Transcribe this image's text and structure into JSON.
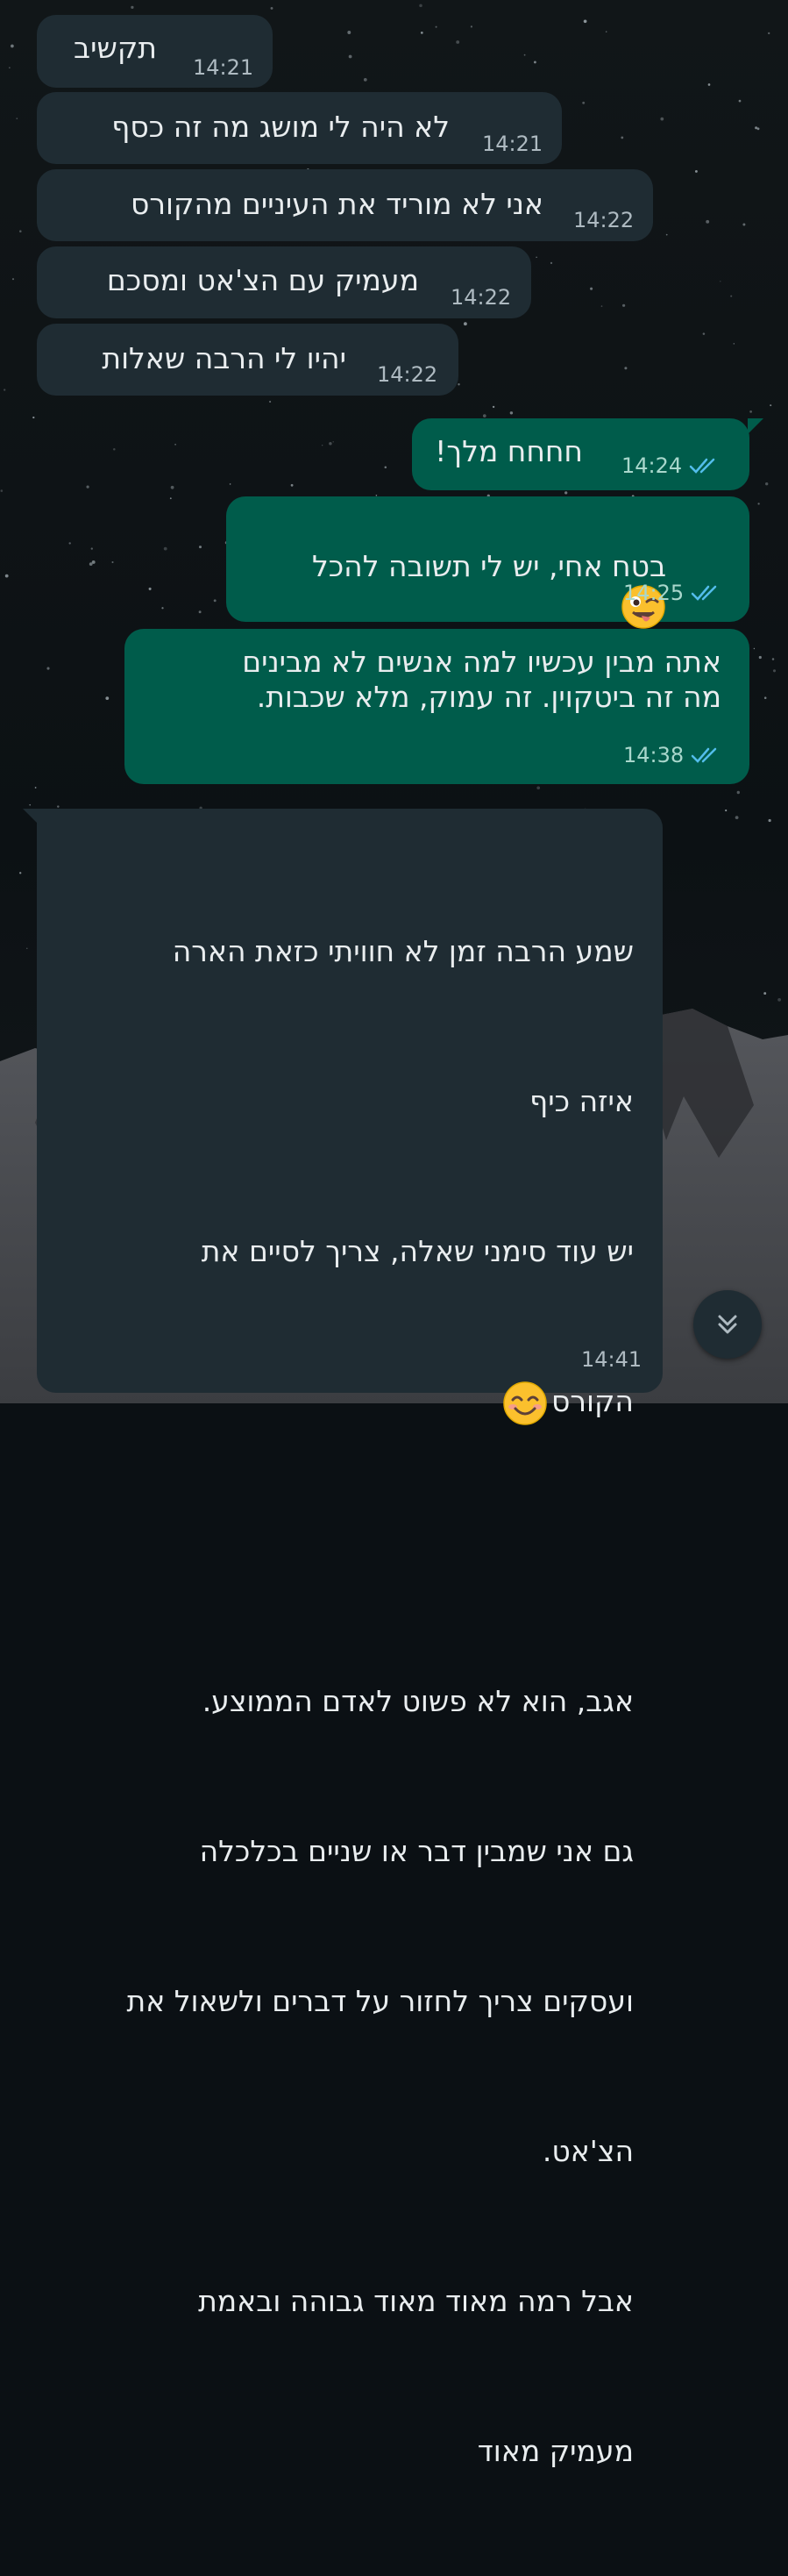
{
  "messages": [
    {
      "dir": "in",
      "text": "תקשיב",
      "time": "14:21"
    },
    {
      "dir": "in",
      "text": "לא היה לי מושג מה זה כסף",
      "time": "14:21"
    },
    {
      "dir": "in",
      "text": "אני לא מוריד את העיניים מהקורס",
      "time": "14:22"
    },
    {
      "dir": "in",
      "text": "מעמיק עם הצ'אט ומסכם",
      "time": "14:22"
    },
    {
      "dir": "in",
      "text": "יהיו לי הרבה שאלות",
      "time": "14:22"
    },
    {
      "dir": "out",
      "text": "חחחח מלך!",
      "time": "14:24",
      "status": "read"
    },
    {
      "dir": "out",
      "text": "בטח אחי, יש לי תשובה להכל",
      "emoji": "winking-face-with-tongue",
      "time": "14:25",
      "status": "read"
    },
    {
      "dir": "out",
      "lines": [
        "אתה מבין עכשיו למה אנשים לא מבינים",
        "מה זה ביטקוין. זה עמוק, מלא שכבות."
      ],
      "time": "14:38",
      "status": "read"
    },
    {
      "dir": "in",
      "lines": [
        "שמע הרבה זמן לא חוויתי כזאת הארה",
        "איזה כיף",
        "יש עוד סימני שאלה, צריך לסיים את",
        "הקורס",
        "",
        "אגב, הוא לא פשוט לאדם הממוצע.",
        "גם אני שמבין דבר או שניים בכלכלה",
        "ועסקים צריך לחזור על דברים ולשאול את",
        "הצ'אט.",
        "אבל רמה מאוד מאוד גבוהה ובאמת",
        "מעמיק מאוד"
      ],
      "emoji_after_line": 3,
      "emoji": "smiling-face-with-smiling-eyes",
      "time": "14:41"
    }
  ],
  "colors": {
    "incoming_bubble": "#1f2c33",
    "outgoing_bubble": "#005c4b",
    "read_ticks": "#53bdeb",
    "text": "#e9edef"
  },
  "scroll_button": {
    "icon": "double-chevron-down-icon"
  }
}
